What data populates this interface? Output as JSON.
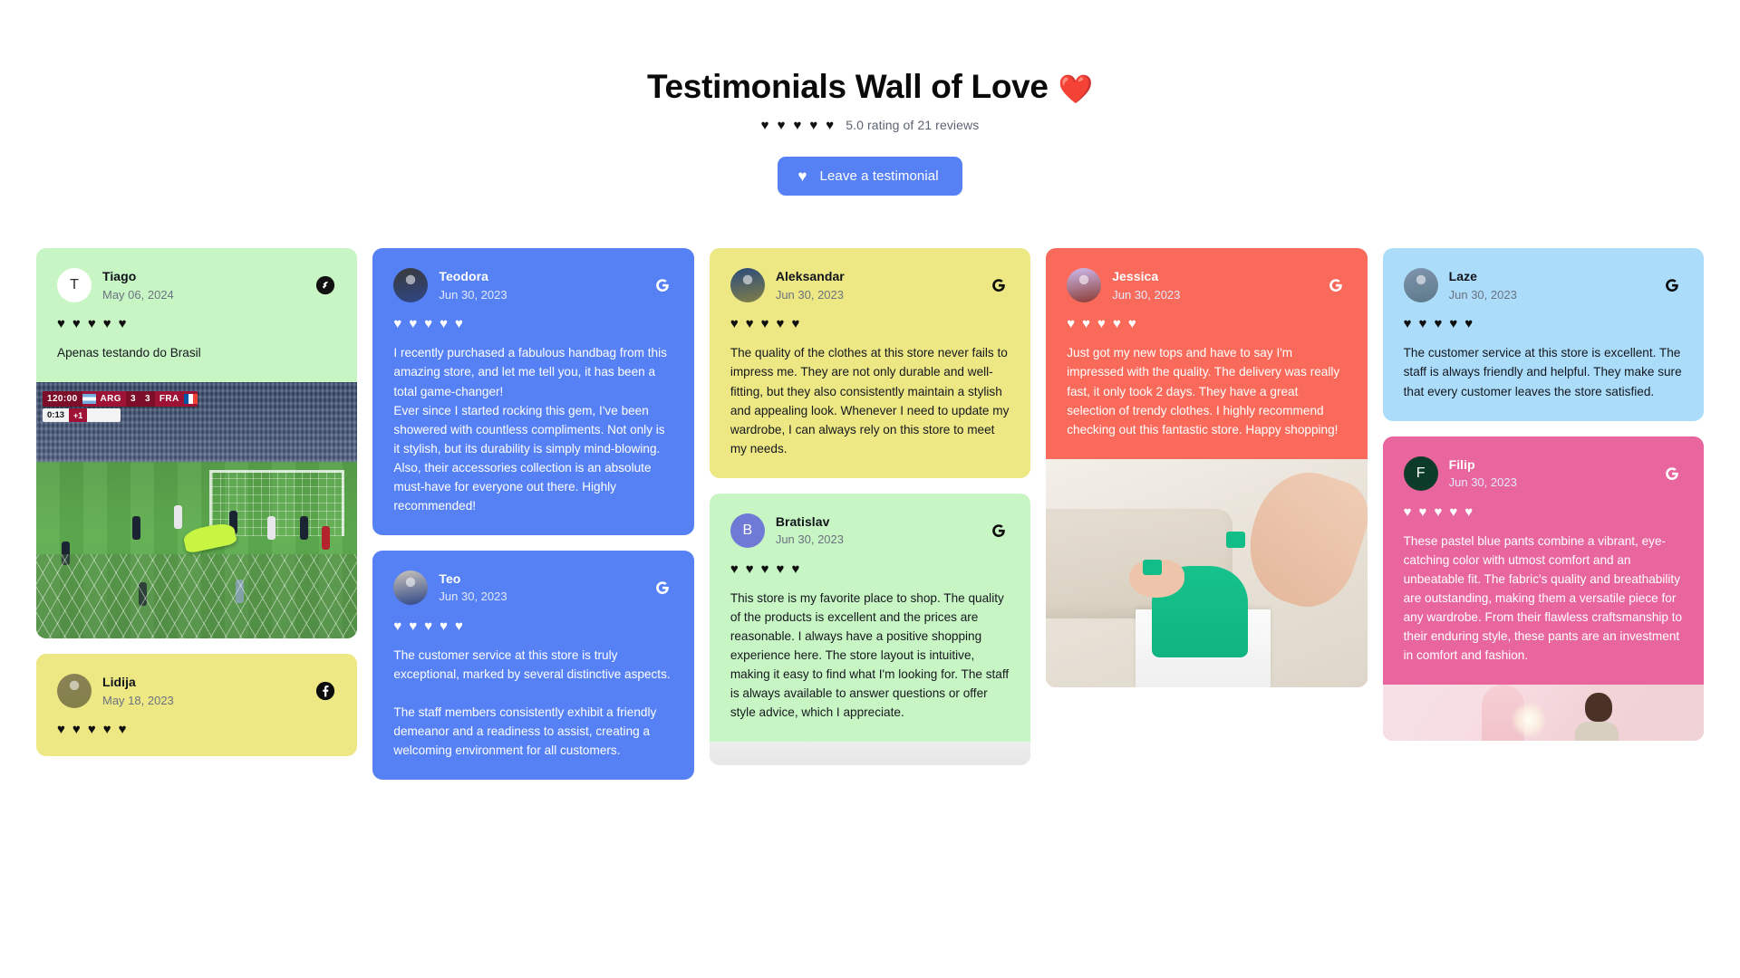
{
  "header": {
    "title": "Testimonials Wall of Love",
    "title_heart": "❤️",
    "rating_stars": [
      "♥",
      "♥",
      "♥",
      "♥",
      "♥"
    ],
    "rating_text": "5.0 rating of 21 reviews",
    "cta_label": "Leave a testimonial",
    "cta_heart": "♥",
    "cta_color": "#5681f5"
  },
  "columns": [
    {
      "cards": [
        {
          "name": "Tiago",
          "date": "May 06, 2024",
          "initial": "T",
          "avatar_type": "initial",
          "avatar_bg": "#ffffff",
          "avatar_fg": "#2b2b2b",
          "source": "senja",
          "bg": "#c8f5c4",
          "theme": "dark",
          "hearts": [
            "♥",
            "♥",
            "♥",
            "♥",
            "♥"
          ],
          "text": "Apenas testando do Brasil",
          "media": "football",
          "media_overlay": {
            "clock": "120:00",
            "home": "ARG",
            "home_score": "3",
            "away": "FRA",
            "away_score": "3",
            "sub_clock": "0:13",
            "sub_badge": "+1"
          }
        },
        {
          "name": "Lidija",
          "date": "May 18, 2023",
          "initial": "L",
          "avatar_type": "photo",
          "avatar_bg": "#8b8257",
          "avatar_fg": "#ffffff",
          "source": "facebook",
          "bg": "#ede884",
          "theme": "dark",
          "hearts": [
            "♥",
            "♥",
            "♥",
            "♥",
            "♥"
          ],
          "text": "",
          "media": "none"
        }
      ]
    },
    {
      "cards": [
        {
          "name": "Teodora",
          "date": "Jun 30, 2023",
          "initial": "T",
          "avatar_type": "photo",
          "avatar_bg": "#3a3a3a",
          "avatar_fg": "#ffffff",
          "source": "google-white",
          "bg": "#5681f5",
          "theme": "light",
          "hearts": [
            "♥",
            "♥",
            "♥",
            "♥",
            "♥"
          ],
          "text": "I recently purchased a fabulous handbag from this amazing store, and let me tell you, it has been a total game-changer!\nEver since I started rocking this gem, I've been showered with countless compliments. Not only is it stylish, but its durability is simply mind-blowing.\nAlso, their accessories collection is an absolute must-have for everyone out there. Highly recommended!",
          "media": "none"
        },
        {
          "name": "Teo",
          "date": "Jun 30, 2023",
          "initial": "T",
          "avatar_type": "photo",
          "avatar_bg": "#c9c3bb",
          "avatar_fg": "#ffffff",
          "source": "google-white",
          "bg": "#5681f5",
          "theme": "light",
          "hearts": [
            "♥",
            "♥",
            "♥",
            "♥",
            "♥"
          ],
          "text": "The customer service at this store is truly exceptional, marked by several distinctive aspects.\n\nThe staff members consistently exhibit a friendly demeanor and a readiness to assist, creating a welcoming environment for all customers.",
          "media": "none"
        }
      ]
    },
    {
      "cards": [
        {
          "name": "Aleksandar",
          "date": "Jun 30, 2023",
          "initial": "A",
          "avatar_type": "photo",
          "avatar_bg": "#2a4a7a",
          "avatar_fg": "#ffffff",
          "source": "google-black",
          "bg": "#ede884",
          "theme": "dark",
          "hearts": [
            "♥",
            "♥",
            "♥",
            "♥",
            "♥"
          ],
          "text": "The quality of the clothes at this store never fails to impress me. They are not only durable and well-fitting, but they also consistently maintain a stylish and appealing look. Whenever I need to update my wardrobe, I can always rely on this store to meet my needs.",
          "media": "none"
        },
        {
          "name": "Bratislav",
          "date": "Jun 30, 2023",
          "initial": "B",
          "avatar_type": "initial",
          "avatar_bg": "#6f7ad6",
          "avatar_fg": "#ffffff",
          "source": "google-black",
          "bg": "#c8f5c4",
          "theme": "dark",
          "hearts": [
            "♥",
            "♥",
            "♥",
            "♥",
            "♥"
          ],
          "text": "This store is my favorite place to shop. The quality of the products is excellent and the prices are reasonable. I always have a positive shopping experience here. The store layout is intuitive, making it easy to find what I'm looking for. The staff is always available to answer questions or offer style advice, which I appreciate.",
          "media": "grey"
        }
      ]
    },
    {
      "cards": [
        {
          "name": "Jessica",
          "date": "Jun 30, 2023",
          "initial": "J",
          "avatar_type": "photo",
          "avatar_bg": "#cdbbf0",
          "avatar_fg": "#ffffff",
          "source": "google-white",
          "bg": "#fa6a5a",
          "theme": "light",
          "hearts": [
            "♥",
            "♥",
            "♥",
            "♥",
            "♥"
          ],
          "text": "Just got my new tops and have to say I'm impressed with the quality. The delivery was really fast, it only took 2 days. They have a great selection of trendy clothes. I highly recommend checking out this fantastic store. Happy shopping!",
          "media": "green-top"
        }
      ]
    },
    {
      "cards": [
        {
          "name": "Laze",
          "date": "Jun 30, 2023",
          "initial": "L",
          "avatar_type": "photo",
          "avatar_bg": "#7d94ad",
          "avatar_fg": "#ffffff",
          "source": "google-black",
          "bg": "#abddfb",
          "theme": "dark",
          "hearts": [
            "♥",
            "♥",
            "♥",
            "♥",
            "♥"
          ],
          "text": "The customer service at this store is excellent. The staff is always friendly and helpful. They make sure that every customer leaves the store satisfied.",
          "media": "none"
        },
        {
          "name": "Filip",
          "date": "Jun 30, 2023",
          "initial": "F",
          "avatar_type": "initial",
          "avatar_bg": "#0d3b2a",
          "avatar_fg": "#ffffff",
          "source": "google-white",
          "bg": "#e8659d",
          "theme": "light",
          "hearts": [
            "♥",
            "♥",
            "♥",
            "♥",
            "♥"
          ],
          "text": "These pastel blue pants combine a vibrant, eye-catching color with utmost comfort and an unbeatable fit. The fabric's quality and breathability are outstanding, making them a versatile piece for any wardrobe. From their flawless craftsmanship to their enduring style, these pants are an investment in comfort and fashion.",
          "media": "store"
        }
      ]
    }
  ]
}
